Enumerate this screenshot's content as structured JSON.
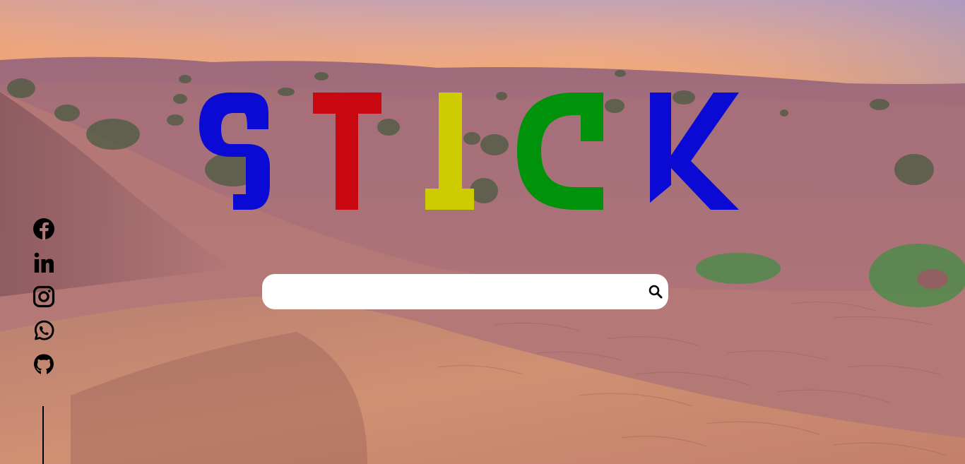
{
  "background": {
    "description_colors": {
      "sky_top": "#b49bb8",
      "sky_horizon": "#f2a774",
      "sand_far": "#a8707a",
      "sand_mid": "#b67a7d",
      "sand_near": "#c98770"
    }
  },
  "logo": {
    "letters": [
      {
        "char": "S",
        "color": "#0a0ad4"
      },
      {
        "char": "T",
        "color": "#c80710"
      },
      {
        "char": "I",
        "color": "#cccc00"
      },
      {
        "char": "C",
        "color": "#00920a"
      },
      {
        "char": "K",
        "color": "#0a0ad4"
      }
    ]
  },
  "search": {
    "value": "",
    "placeholder": "",
    "button_icon": "search-icon"
  },
  "social": {
    "items": [
      {
        "name": "facebook",
        "icon": "facebook-icon"
      },
      {
        "name": "linkedin",
        "icon": "linkedin-icon"
      },
      {
        "name": "instagram",
        "icon": "instagram-icon"
      },
      {
        "name": "whatsapp",
        "icon": "whatsapp-icon"
      },
      {
        "name": "github",
        "icon": "github-icon"
      }
    ]
  }
}
